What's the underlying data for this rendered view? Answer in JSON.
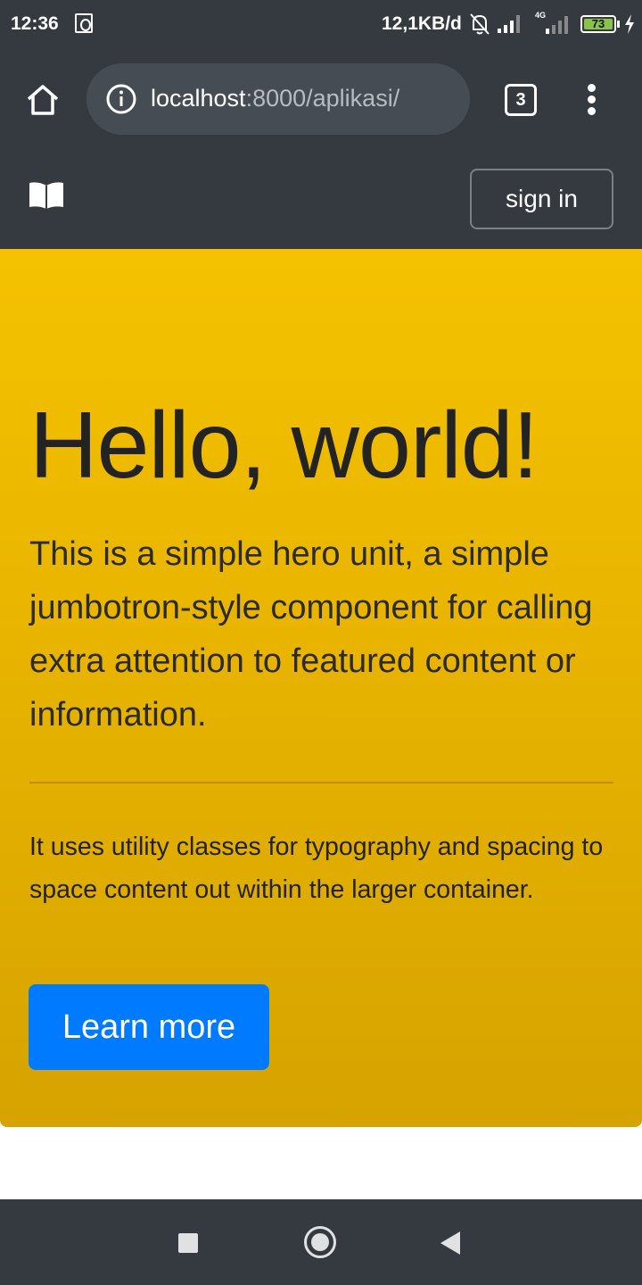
{
  "status_bar": {
    "time": "12:36",
    "network_speed": "12,1KB/d",
    "network_type": "4G",
    "battery": "73",
    "icons": [
      "notification-icon",
      "bell-off-icon",
      "signal-icon",
      "signal-4g-icon",
      "battery-icon",
      "charging-icon"
    ]
  },
  "browser": {
    "url_host": "localhost",
    "url_path": ":8000/aplikasi/",
    "tab_count": "3"
  },
  "navbar": {
    "brand_icon": "book-icon",
    "signin_label": "sign in"
  },
  "hero": {
    "title": "Hello, world!",
    "lead": "This is a simple hero unit, a simple jumbotron-style component for calling extra attention to featured content or information.",
    "text": "It uses utility classes for typography and spacing to space content out within the larger container.",
    "button_label": "Learn more"
  },
  "colors": {
    "dark": "#343a40",
    "hero": "#f0bd00",
    "primary": "#007bff"
  }
}
